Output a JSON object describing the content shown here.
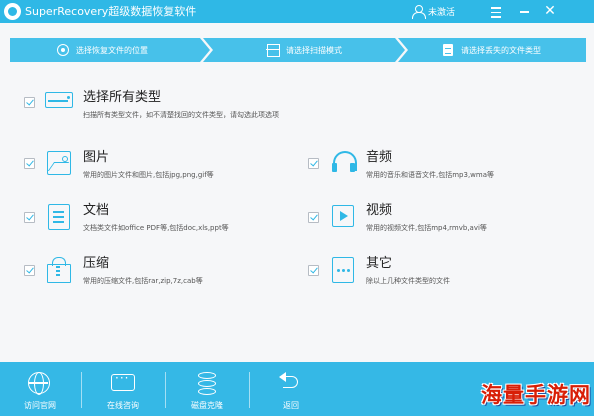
{
  "app": {
    "title": "SuperRecovery超级数据恢复软件",
    "user_label": "未激活",
    "accent_color": "#2fb8e6"
  },
  "window_controls": {
    "menu_icon": "hamburger-icon",
    "minimize_icon": "minimize-icon",
    "close_icon": "close-icon",
    "close_glyph": "✕"
  },
  "steps": [
    {
      "label": "选择恢复文件的位置",
      "icon": "target-icon"
    },
    {
      "label": "请选择扫描模式",
      "icon": "scan-icon"
    },
    {
      "label": "请选择丢失的文件类型",
      "icon": "file-icon"
    }
  ],
  "select_all": {
    "title": "选择所有类型",
    "description": "扫描所有类型文件，如不清楚找回的文件类型，请勾选此项选项",
    "checked": true,
    "icon": "drive-icon"
  },
  "categories": {
    "image": {
      "title": "图片",
      "description": "常用的图片文件和图片,包括jpg,png,gif等",
      "checked": true,
      "icon": "image-icon"
    },
    "audio": {
      "title": "音频",
      "description": "常用的音乐和语音文件,包括mp3,wma等",
      "checked": true,
      "icon": "headphones-icon"
    },
    "document": {
      "title": "文档",
      "description": "文档类文件如office PDF等,包括doc,xls,ppt等",
      "checked": true,
      "icon": "document-icon"
    },
    "video": {
      "title": "视频",
      "description": "常用的视频文件,包括mp4,rmvb,avi等",
      "checked": true,
      "icon": "video-icon"
    },
    "archive": {
      "title": "压缩",
      "description": "常用的压缩文件,包括rar,zip,7z,cab等",
      "checked": true,
      "icon": "archive-icon"
    },
    "other": {
      "title": "其它",
      "description": "除以上几种文件类型的文件",
      "checked": true,
      "icon": "other-file-icon"
    }
  },
  "bottom_bar": [
    {
      "label": "访问官网",
      "icon": "globe-icon"
    },
    {
      "label": "在线咨询",
      "icon": "chat-icon"
    },
    {
      "label": "磁盘克隆",
      "icon": "database-icon"
    },
    {
      "label": "返回",
      "icon": "back-icon"
    }
  ],
  "watermark": "海量手游网"
}
